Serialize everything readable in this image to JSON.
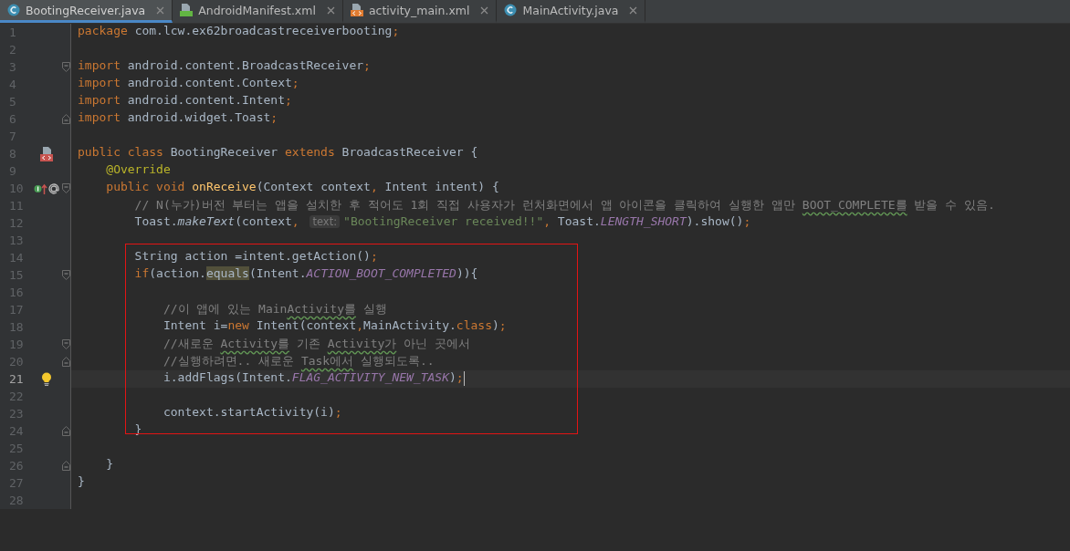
{
  "tabs": [
    {
      "label": "BootingReceiver.java",
      "kind": "class",
      "selected": true
    },
    {
      "label": "AndroidManifest.xml",
      "kind": "manifest",
      "selected": false
    },
    {
      "label": "activity_main.xml",
      "kind": "xml",
      "selected": false
    },
    {
      "label": "MainActivity.java",
      "kind": "class",
      "selected": false
    }
  ],
  "editor": {
    "blocks": [
      {
        "boxed": false,
        "lines": [
          {
            "number": "1",
            "current": false,
            "tokens": [
              {
                "kind": "kw",
                "text": "package "
              },
              {
                "kind": "p",
                "text": "com.lcw.ex62broadcastreceiverbooting"
              },
              {
                "kind": "kw",
                "text": ";"
              }
            ]
          },
          {
            "number": "2",
            "current": false
          },
          {
            "number": "3",
            "current": false,
            "fold": {
              "kind": "start"
            },
            "tokens": [
              {
                "kind": "kw",
                "text": "import "
              },
              {
                "kind": "p",
                "text": "android.content.BroadcastReceiver"
              },
              {
                "kind": "kw",
                "text": ";"
              }
            ]
          },
          {
            "number": "4",
            "current": false,
            "tokens": [
              {
                "kind": "kw",
                "text": "import "
              },
              {
                "kind": "p",
                "text": "android.content.Context"
              },
              {
                "kind": "kw",
                "text": ";"
              }
            ]
          },
          {
            "number": "5",
            "current": false,
            "tokens": [
              {
                "kind": "kw",
                "text": "import "
              },
              {
                "kind": "p",
                "text": "android.content.Intent"
              },
              {
                "kind": "kw",
                "text": ";"
              }
            ]
          },
          {
            "number": "6",
            "current": false,
            "fold": {
              "kind": "end"
            },
            "tokens": [
              {
                "kind": "kw",
                "text": "import "
              },
              {
                "kind": "p",
                "text": "android.widget.Toast"
              },
              {
                "kind": "kw",
                "text": ";"
              }
            ]
          },
          {
            "number": "7",
            "current": false
          },
          {
            "number": "8",
            "current": false,
            "gutter_icon": {
              "kind": "xml"
            },
            "tokens": [
              {
                "kind": "kw",
                "text": "public class "
              },
              {
                "kind": "p",
                "text": "BootingReceiver "
              },
              {
                "kind": "kw",
                "text": "extends "
              },
              {
                "kind": "p",
                "text": "BroadcastReceiver {"
              }
            ]
          },
          {
            "number": "9",
            "current": false,
            "tokens": [
              {
                "kind": "annot",
                "text": "    @Override"
              }
            ]
          },
          {
            "number": "10",
            "current": false,
            "gutter_icon": {
              "kind": "override"
            },
            "fold": {
              "kind": "start"
            },
            "tokens": [
              {
                "kind": "kw",
                "text": "    public void "
              },
              {
                "kind": "fn",
                "text": "onReceive"
              },
              {
                "kind": "p",
                "text": "(Context context"
              },
              {
                "kind": "kw",
                "text": ","
              },
              {
                "kind": "p",
                "text": " Intent intent) {"
              }
            ]
          },
          {
            "number": "11",
            "current": false,
            "tokens": [
              {
                "kind": "c",
                "text": "        // N(누가)버전 부터는 앱을 설치한 후 적어도 1회 직접 사용자가 런처화면에서 앱 아이콘을 클릭하여 실행한 앱만 "
              },
              {
                "kind": "typo",
                "text": "BOOT_COMPLETE를"
              },
              {
                "kind": "c",
                "text": " 받을 수 있음."
              }
            ]
          },
          {
            "number": "12",
            "current": false,
            "tokens": [
              {
                "kind": "p",
                "text": "        Toast."
              },
              {
                "kind": "static",
                "text": "makeText"
              },
              {
                "kind": "p",
                "text": "(context"
              },
              {
                "kind": "kw",
                "text": ", "
              },
              {
                "kind": "hint",
                "text": "text:"
              },
              {
                "kind": "str",
                "text": "\"BootingReceiver received!!\""
              },
              {
                "kind": "kw",
                "text": ","
              },
              {
                "kind": "p",
                "text": " Toast."
              },
              {
                "kind": "const",
                "text": "LENGTH_SHORT"
              },
              {
                "kind": "p",
                "text": ").show()"
              },
              {
                "kind": "kw",
                "text": ";"
              }
            ]
          },
          {
            "number": "13",
            "current": false
          }
        ]
      },
      {
        "boxed": true,
        "lines": [
          {
            "number": "14",
            "current": false,
            "tokens": [
              {
                "kind": "p",
                "text": "        String action =intent.getAction()"
              },
              {
                "kind": "kw",
                "text": ";"
              }
            ]
          },
          {
            "number": "15",
            "current": false,
            "fold": {
              "kind": "start"
            },
            "tokens": [
              {
                "kind": "kw",
                "text": "        if"
              },
              {
                "kind": "p",
                "text": "(action."
              },
              {
                "kind": "usage",
                "text": "equals"
              },
              {
                "kind": "p",
                "text": "(Intent."
              },
              {
                "kind": "const",
                "text": "ACTION_BOOT_COMPLETED"
              },
              {
                "kind": "p",
                "text": ")){"
              }
            ]
          },
          {
            "number": "16",
            "current": false
          },
          {
            "number": "17",
            "current": false,
            "tokens": [
              {
                "kind": "c",
                "text": "            //이 앱에 있는 Main"
              },
              {
                "kind": "typo",
                "text": "Activity를"
              },
              {
                "kind": "c",
                "text": " 실행"
              }
            ]
          },
          {
            "number": "18",
            "current": false,
            "tokens": [
              {
                "kind": "p",
                "text": "            Intent i="
              },
              {
                "kind": "kw",
                "text": "new "
              },
              {
                "kind": "p",
                "text": "Intent(context"
              },
              {
                "kind": "kw",
                "text": ","
              },
              {
                "kind": "p",
                "text": "MainActivity."
              },
              {
                "kind": "kw",
                "text": "class"
              },
              {
                "kind": "p",
                "text": ")"
              },
              {
                "kind": "kw",
                "text": ";"
              }
            ]
          },
          {
            "number": "19",
            "current": false,
            "fold": {
              "kind": "start"
            },
            "tokens": [
              {
                "kind": "c",
                "text": "            //새로운 "
              },
              {
                "kind": "typo",
                "text": "Activity를"
              },
              {
                "kind": "c",
                "text": " 기존 "
              },
              {
                "kind": "typo",
                "text": "Activity가"
              },
              {
                "kind": "c",
                "text": " 아닌 곳에서"
              }
            ]
          },
          {
            "number": "20",
            "current": false,
            "fold": {
              "kind": "end"
            },
            "tokens": [
              {
                "kind": "c",
                "text": "            //실행하려면.. 새로운 "
              },
              {
                "kind": "typo",
                "text": "Task에서"
              },
              {
                "kind": "c",
                "text": " 실행되도록.."
              }
            ]
          },
          {
            "number": "21",
            "current": true,
            "gutter_icon": {
              "kind": "bulb"
            },
            "tokens": [
              {
                "kind": "p",
                "text": "            i.addFlags(Intent."
              },
              {
                "kind": "const",
                "text": "FLAG_ACTIVITY_NEW_TASK"
              },
              {
                "kind": "p",
                "text": ")"
              },
              {
                "kind": "kw",
                "text": ";"
              }
            ]
          },
          {
            "number": "22",
            "current": false
          },
          {
            "number": "23",
            "current": false,
            "tokens": [
              {
                "kind": "p",
                "text": "            context.startActivity(i)"
              },
              {
                "kind": "kw",
                "text": ";"
              }
            ]
          },
          {
            "number": "24",
            "current": false,
            "fold": {
              "kind": "end"
            },
            "tokens": [
              {
                "kind": "p",
                "text": "        }"
              }
            ]
          }
        ]
      },
      {
        "boxed": false,
        "lines": [
          {
            "number": "25",
            "current": false
          },
          {
            "number": "26",
            "current": false,
            "fold": {
              "kind": "end"
            },
            "tokens": [
              {
                "kind": "p",
                "text": "    }"
              }
            ]
          },
          {
            "number": "27",
            "current": false,
            "tokens": [
              {
                "kind": "p",
                "text": "}"
              }
            ]
          },
          {
            "number": "28",
            "current": false
          }
        ]
      }
    ]
  }
}
